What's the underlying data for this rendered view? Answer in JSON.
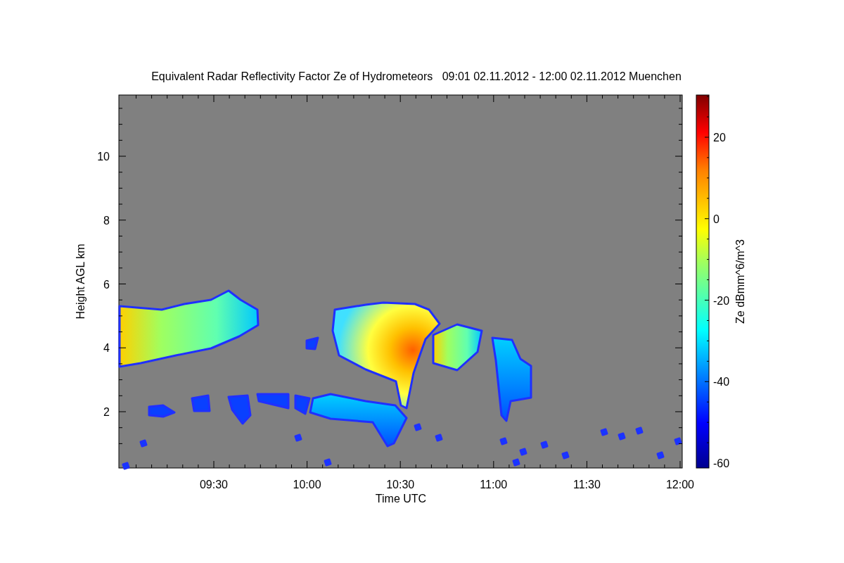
{
  "title": "Equivalent Radar Reflectivity Factor Ze of Hydrometeors   09:01 02.11.2012 - 12:00 02.11.2012 Muenchen",
  "y_axis": {
    "label": "Height AGL km",
    "ticks": [
      "10",
      "8",
      "6",
      "4",
      "2"
    ]
  },
  "x_axis": {
    "label": "Time UTC",
    "ticks": [
      "09:30",
      "10:00",
      "10:30",
      "11:00",
      "11:30",
      "12:00"
    ]
  },
  "colorbar": {
    "label": "Ze dBmm^6/m^3",
    "ticks": [
      "20",
      "0",
      "-20",
      "-40",
      "-60"
    ]
  }
}
